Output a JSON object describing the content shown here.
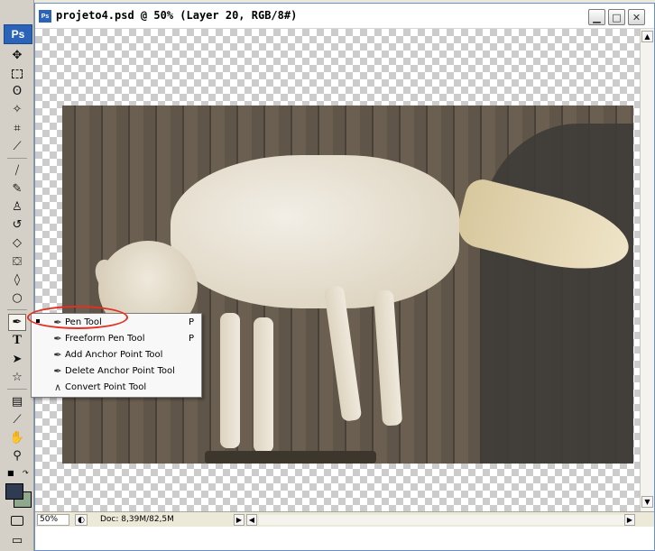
{
  "app": {
    "logo_text": "Ps"
  },
  "window": {
    "title": "projeto4.psd @ 50% (Layer 20, RGB/8#)",
    "title_icon_text": "Ps",
    "buttons": [
      "minimize",
      "maximize",
      "close"
    ]
  },
  "status": {
    "zoom": "50%",
    "doc_size": "Doc: 8,39M/82,5M"
  },
  "flyout": {
    "items": [
      {
        "label": "Pen Tool",
        "key": "P",
        "selected": true,
        "icon": "pen-icon"
      },
      {
        "label": "Freeform Pen Tool",
        "key": "P",
        "selected": false,
        "icon": "freeform-pen-icon"
      },
      {
        "label": "Add Anchor Point Tool",
        "key": "",
        "selected": false,
        "icon": "add-anchor-icon"
      },
      {
        "label": "Delete Anchor Point Tool",
        "key": "",
        "selected": false,
        "icon": "delete-anchor-icon"
      },
      {
        "label": "Convert Point Tool",
        "key": "",
        "selected": false,
        "icon": "convert-point-icon"
      }
    ]
  },
  "colors": {
    "foreground": "#2e3b50",
    "background": "#8fa98c",
    "highlight": "#e23022",
    "accent": "#2b63b8"
  },
  "toolbar": {
    "type_tool_glyph": "T"
  }
}
